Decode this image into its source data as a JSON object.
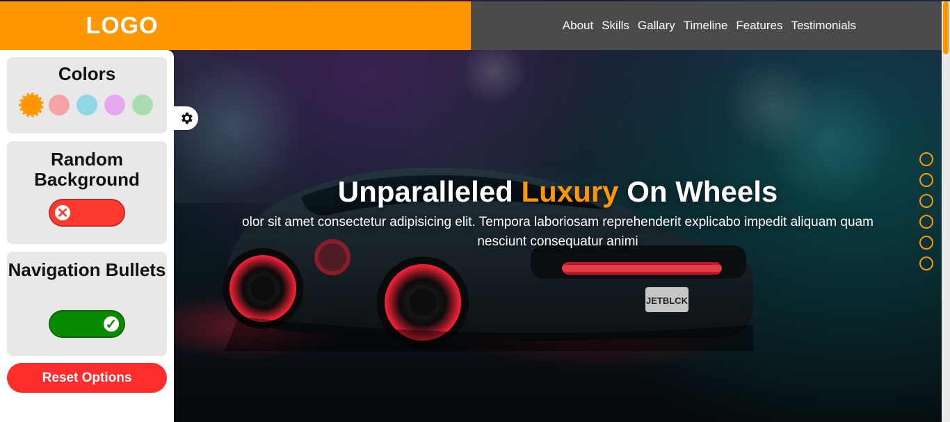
{
  "header": {
    "logo": "LOGO",
    "nav": [
      "About",
      "Skills",
      "Gallary",
      "Timeline",
      "Features",
      "Testimonials"
    ]
  },
  "settings_panel": {
    "colors": {
      "title": "Colors",
      "swatches": [
        {
          "name": "orange",
          "hex": "#ff9800",
          "active": true
        },
        {
          "name": "pink",
          "hex": "#f4a4a4",
          "active": false
        },
        {
          "name": "blue",
          "hex": "#8fd6e8",
          "active": false
        },
        {
          "name": "purple",
          "hex": "#e5a8ef",
          "active": false
        },
        {
          "name": "green",
          "hex": "#a8ddb0",
          "active": false
        }
      ]
    },
    "random_background": {
      "title": "Random Background",
      "state": "off"
    },
    "navigation_bullets": {
      "title": "Navigation Bullets",
      "state": "on"
    },
    "reset_label": "Reset Options",
    "settings_icon": "gear-icon"
  },
  "hero": {
    "title_prefix": "Unparalleled ",
    "title_accent": "Luxury",
    "title_suffix": " On Wheels",
    "subtitle": "olor sit amet consectetur adipisicing elit. Tempora laboriosam reprehenderit explicabo impedit aliquam quam nesciunt consequatur animi",
    "car_plate": "JETBLCK"
  },
  "nav_bullets": {
    "count": 6,
    "accent": "#ff9800"
  },
  "colors": {
    "accent": "#ff9800",
    "header_dark": "#4b4b4b",
    "panel_card": "#e8e8e8",
    "danger": "#ff2d2d",
    "success": "#0a8a00"
  }
}
